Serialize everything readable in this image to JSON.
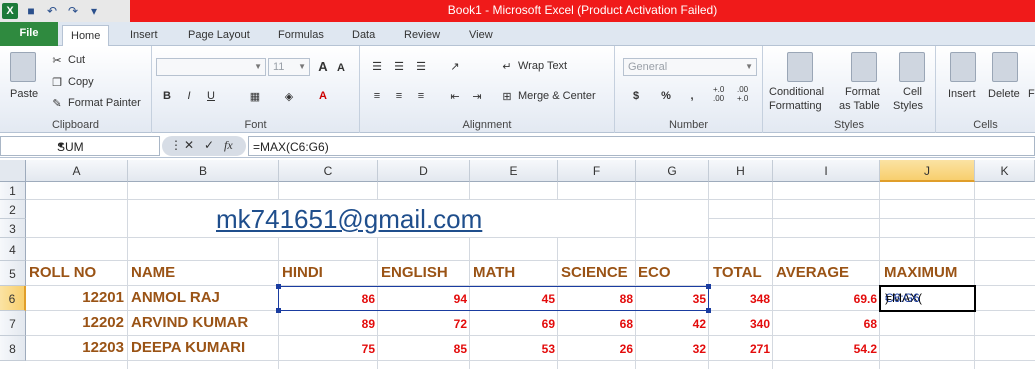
{
  "window": {
    "title": "Book1  -  Microsoft Excel (Product Activation Failed)",
    "logo_text": "X"
  },
  "tabs": {
    "file": "File",
    "items": [
      "Home",
      "Insert",
      "Page Layout",
      "Formulas",
      "Data",
      "Review",
      "View"
    ]
  },
  "ribbon": {
    "clipboard": {
      "paste": "Paste",
      "cut": "Cut",
      "copy": "Copy",
      "format_painter": "Format Painter",
      "label": "Clipboard"
    },
    "font": {
      "size": "11",
      "grow": "A",
      "shrink": "A",
      "bold": "B",
      "italic": "I",
      "underline": "U",
      "font_color": "A",
      "label": "Font"
    },
    "alignment": {
      "wrap_text": "Wrap Text",
      "merge_center": "Merge & Center",
      "label": "Alignment"
    },
    "number": {
      "format": "General",
      "currency": "$",
      "percent": "%",
      "comma": ",",
      "inc_dec": "+.0 .00",
      "dec_dec": ".00 +.0",
      "label": "Number"
    },
    "styles": {
      "conditional": "Conditional",
      "formatting": "Formatting",
      "format_as": "Format",
      "as_table": "as Table",
      "cell": "Cell",
      "cell_styles": "Styles",
      "label": "Styles"
    },
    "cells": {
      "insert": "Insert",
      "delete": "Delete",
      "format": "F",
      "label": "Cells"
    }
  },
  "formula_bar": {
    "name_box": "SUM",
    "fx": "fx",
    "cancel": "✕",
    "enter": "✓",
    "formula": "=MAX(C6:G6)"
  },
  "columns": [
    "A",
    "B",
    "C",
    "D",
    "E",
    "F",
    "G",
    "H",
    "I",
    "J",
    "K"
  ],
  "rows": [
    "1",
    "2",
    "3",
    "4",
    "5",
    "6",
    "7",
    "8"
  ],
  "sheet": {
    "email": "mk741651@gmail.com",
    "headers": [
      "ROLL NO",
      "NAME",
      "HINDI",
      "ENGLISH",
      "MATH",
      "SCIENCE",
      "ECO",
      "TOTAL",
      "AVERAGE",
      "MAXIMUM"
    ],
    "records": [
      {
        "roll": "12201",
        "name": "ANMOL RAJ",
        "hindi": "86",
        "english": "94",
        "math": "45",
        "science": "88",
        "eco": "35",
        "total": "348",
        "average": "69.6"
      },
      {
        "roll": "12202",
        "name": "ARVIND KUMAR",
        "hindi": "89",
        "english": "72",
        "math": "69",
        "science": "68",
        "eco": "42",
        "total": "340",
        "average": "68"
      },
      {
        "roll": "12203",
        "name": "DEEPA KUMARI",
        "hindi": "75",
        "english": "85",
        "math": "53",
        "science": "26",
        "eco": "32",
        "total": "271",
        "average": "54.2"
      }
    ],
    "active_cell": {
      "prefix": "=MAX(",
      "ref": "C6:G6",
      "suffix": ")"
    }
  }
}
